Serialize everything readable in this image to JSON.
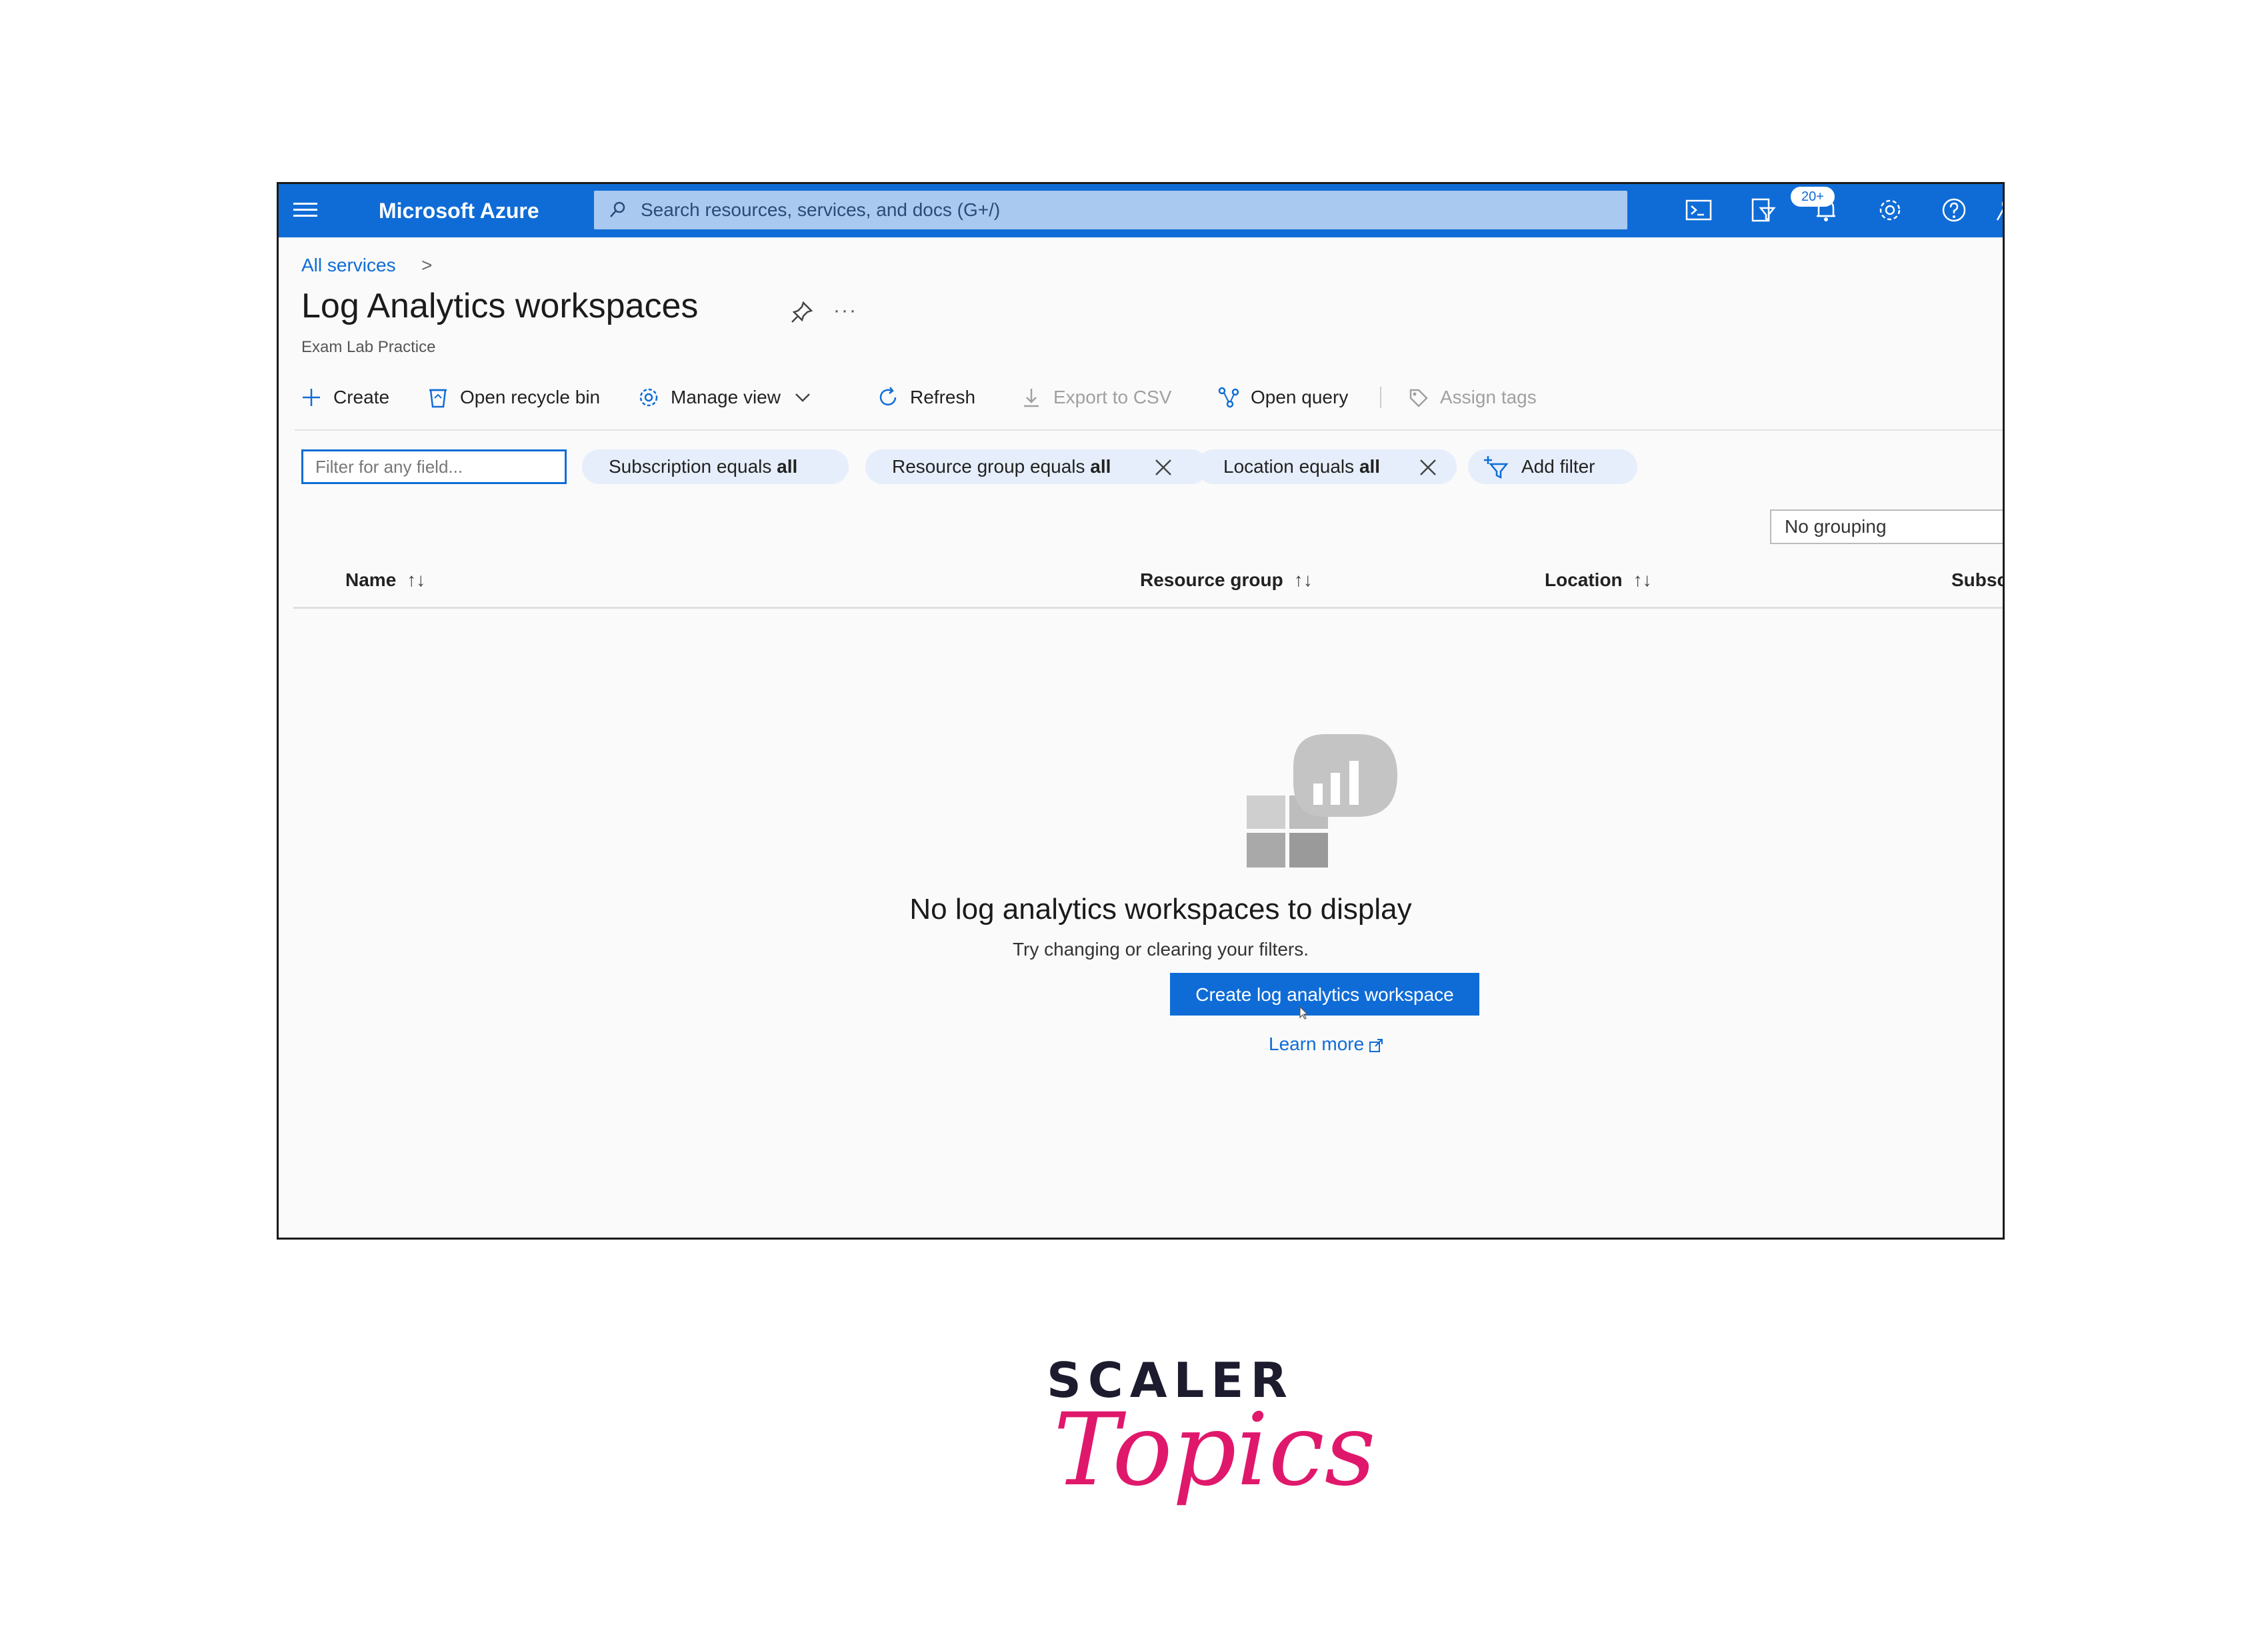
{
  "topbar": {
    "brand": "Microsoft Azure",
    "search_placeholder": "Search resources, services, and docs (G+/)",
    "notification_badge": "20+",
    "icons": [
      "menu-icon",
      "cloud-shell-icon",
      "directory-filter-icon",
      "notifications-icon",
      "settings-icon",
      "help-icon",
      "feedback-icon"
    ]
  },
  "breadcrumb": {
    "item": "All services",
    "separator": ">"
  },
  "page": {
    "title": "Log Analytics workspaces",
    "subtitle": "Exam Lab Practice",
    "more": "···"
  },
  "toolbar": {
    "create": "Create",
    "recycle": "Open recycle bin",
    "manage_view": "Manage view",
    "refresh": "Refresh",
    "export": "Export to CSV",
    "open_query": "Open query",
    "assign_tags": "Assign tags"
  },
  "filters": {
    "input_placeholder": "Filter for any field...",
    "subscription_label": "Subscription equals",
    "resource_group_label": "Resource group equals",
    "location_label": "Location equals",
    "value_all": "all",
    "add_filter": "Add filter"
  },
  "grouping": {
    "selected": "No grouping"
  },
  "table": {
    "columns": [
      "Name",
      "Resource group",
      "Location",
      "Subscri"
    ]
  },
  "empty_state": {
    "title": "No log analytics workspaces to display",
    "subtitle": "Try changing or clearing your filters.",
    "create_button": "Create log analytics workspace",
    "learn_more": "Learn more"
  },
  "watermark": {
    "line1": "SCALER",
    "line2": "Topics"
  },
  "colors": {
    "azure_blue": "#0f6cd6",
    "brand_pink": "#e0186c"
  }
}
